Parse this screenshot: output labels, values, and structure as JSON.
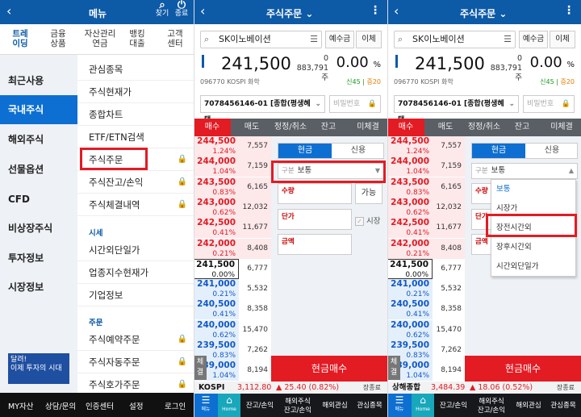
{
  "menu_panel": {
    "title": "메뉴",
    "header_icons": [
      {
        "name": "search",
        "label": "찾기"
      },
      {
        "name": "power",
        "label": "종료"
      }
    ],
    "top_tabs": [
      "트레이딩",
      "금융상품",
      "자산관리연금",
      "뱅킹대출",
      "고객센터"
    ],
    "left_menu": [
      "최근사용",
      "국내주식",
      "해외주식",
      "선물옵션",
      "CFD",
      "비상장주식",
      "투자정보",
      "시장정보"
    ],
    "active_left": "국내주식",
    "banner": {
      "line1": "달려!",
      "line2": "이제 투자의 시대"
    },
    "right_menu": [
      {
        "label": "관심종목",
        "lock": false
      },
      {
        "label": "주식현재가",
        "lock": false
      },
      {
        "label": "종합차트",
        "lock": false
      },
      {
        "label": "ETF/ETN검색",
        "lock": false
      },
      {
        "label": "주식주문",
        "lock": true
      },
      {
        "label": "주식잔고/손익",
        "lock": true
      },
      {
        "label": "주식체결내역",
        "lock": true
      }
    ],
    "section_sise": "시세",
    "sise_menu": [
      {
        "label": "시간외단일가"
      },
      {
        "label": "업종지수현재가"
      },
      {
        "label": "기업정보"
      }
    ],
    "section_order": "주문",
    "order_menu": [
      {
        "label": "주식예약주문",
        "lock": true
      },
      {
        "label": "주식자동주문",
        "lock": true
      },
      {
        "label": "주식호가주문",
        "lock": true
      }
    ],
    "bottom": [
      "MY자산",
      "상담/문의",
      "인증센터",
      "설정",
      "로그인"
    ]
  },
  "order_panel": {
    "title": "주식주문",
    "stock_name": "SK이노베이션",
    "btn_deposit": "예수금",
    "btn_transfer": "이체",
    "price": "241,500",
    "vol_top": "0",
    "vol_bottom": "883,791주",
    "rate": "0.00",
    "rate_unit": "%",
    "code_line": "096770  KOSPI  화학",
    "grade_1": "신45",
    "grade_2": "증20",
    "account": "7078456146-01 [종합(평생혜택...",
    "password_placeholder": "비밀번호",
    "order_tabs": [
      "매수",
      "매도",
      "정정/취소",
      "잔고",
      "미체결"
    ],
    "order_book": [
      {
        "price": "244,500",
        "pct": "1.24%",
        "qty": "7,557",
        "type": "ask"
      },
      {
        "price": "244,000",
        "pct": "1.04%",
        "qty": "7,159",
        "type": "ask"
      },
      {
        "price": "243,500",
        "pct": "0.83%",
        "qty": "6,165",
        "type": "ask"
      },
      {
        "price": "243,000",
        "pct": "0.62%",
        "qty": "12,032",
        "type": "ask"
      },
      {
        "price": "242,500",
        "pct": "0.41%",
        "qty": "11,677",
        "type": "ask"
      },
      {
        "price": "242,000",
        "pct": "0.21%",
        "qty": "8,408",
        "type": "ask"
      },
      {
        "price": "241,500",
        "pct": "0.00%",
        "qty": "6,777",
        "type": "cur"
      },
      {
        "price": "241,000",
        "pct": "0.21%",
        "qty": "5,532",
        "type": "bid"
      },
      {
        "price": "240,500",
        "pct": "0.41%",
        "qty": "8,358",
        "type": "bid"
      },
      {
        "price": "240,000",
        "pct": "0.62%",
        "qty": "15,470",
        "type": "bid"
      },
      {
        "price": "239,500",
        "pct": "0.83%",
        "qty": "7,262",
        "type": "bid"
      },
      {
        "price": "239,000",
        "pct": "1.04%",
        "qty": "8,194",
        "type": "bid"
      }
    ],
    "side_button": "체결",
    "form_tabs": [
      "현금",
      "신용"
    ],
    "type_label": "구분",
    "type_value": "보통",
    "qty_label": "수량",
    "btn_possible": "가능",
    "price_label": "단가",
    "market_label": "시장",
    "amount_label": "금액",
    "buy_button": "현금매수",
    "bottom_nav": {
      "menu": "메뉴",
      "home": "Home",
      "items": [
        "잔고/손익",
        "해외주식\n잔고/손익",
        "해외관심",
        "관심종목"
      ]
    }
  },
  "panel2_index": {
    "name": "KOSPI",
    "value": "3,112.80",
    "change": "▲ 25.40 (0.82%)",
    "end": "장종료"
  },
  "panel3_index": {
    "name": "상해종합",
    "value": "3,484.39",
    "change": "▲ 18.06 (0.52%)",
    "end": "장종료"
  },
  "dropdown_options": [
    "보통",
    "시장가",
    "장전시간외",
    "장후시간외",
    "시간외단일가"
  ],
  "dropdown_selected": "장전시간외",
  "panel3_bottom_items": [
    "잔고/손익",
    "해외주식\n잔고/손익",
    "해외관심",
    "관심종목"
  ]
}
